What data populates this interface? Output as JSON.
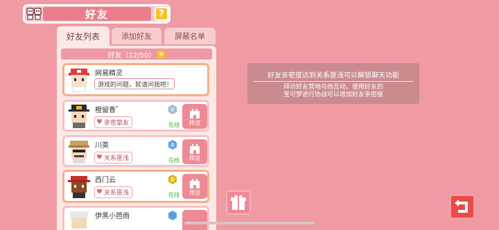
{
  "header": {
    "title": "好友",
    "help_label": "?"
  },
  "tabs": [
    {
      "label": "好友列表",
      "active": true
    },
    {
      "label": "添加好友",
      "active": false
    },
    {
      "label": "屏蔽名单",
      "active": false
    }
  ],
  "friends_count": {
    "text": "好友（12/50）"
  },
  "friends": [
    {
      "name": "网易精灵",
      "message": "游戏的问题，就请问我吧！"
    },
    {
      "name": "橙留香",
      "relation": "亲密挚友",
      "status": "在线",
      "visit_label": "拜访"
    },
    {
      "name": "川英",
      "relation": "关系匪浅",
      "status": "在线",
      "visit_label": "拜访"
    },
    {
      "name": "西门云",
      "relation": "关系匪浅",
      "status": "在线",
      "visit_label": "拜访"
    },
    {
      "name": "伊黑小芭雨",
      "relation": "",
      "status": "",
      "visit_label": ""
    }
  ],
  "info": {
    "line1": "好友亲密度达到关系匪浅可以解锁聊天功能",
    "line2a": "拜访好友营地与他互动，使用好友的",
    "line2b": "宝可梦进行协战可以增加好友亲密度"
  },
  "colors": {
    "background": "#f09aa4",
    "accent": "#ee8a96",
    "online": "#4caf3a",
    "help": "#f7c325",
    "back": "#e94a4a"
  }
}
